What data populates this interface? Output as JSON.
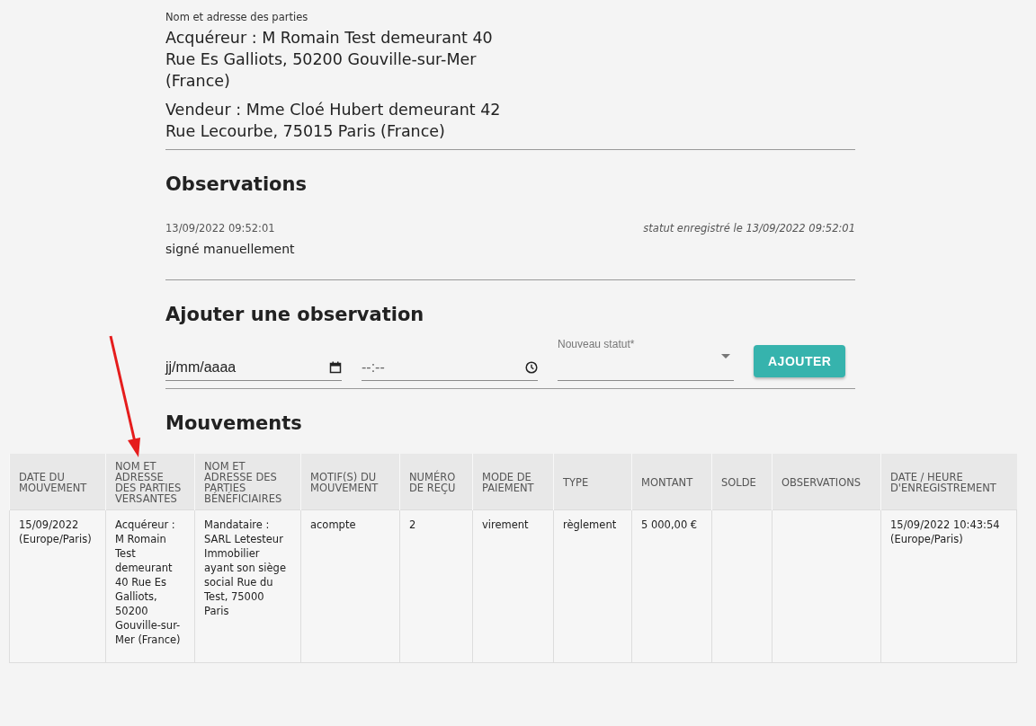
{
  "parties": {
    "label": "Nom et adresse des parties",
    "lines": [
      "Acquéreur : M Romain Test demeurant 40 Rue Es Galliots, 50200 Gouville-sur-Mer (France)",
      "Vendeur : Mme Cloé Hubert demeurant 42 Rue Lecourbe, 75015 Paris (France)"
    ]
  },
  "observations": {
    "title": "Observations",
    "items": [
      {
        "date": "13/09/2022 09:52:01",
        "status_note": "statut enregistré le 13/09/2022 09:52:01",
        "text": "signé manuellement"
      }
    ]
  },
  "add_observation": {
    "title": "Ajouter une observation",
    "date_field": {
      "placeholder": "jj/mm/aaaa"
    },
    "time_field": {
      "placeholder": "--:--"
    },
    "status_select": {
      "label": "Nouveau statut*"
    },
    "button": "AJOUTER"
  },
  "movements": {
    "title": "Mouvements",
    "columns": [
      "DATE DU MOUVEMENT",
      "NOM ET ADRESSE DES PARTIES VERSANTES",
      "NOM ET ADRESSE DES PARTIES BÉNÉFICIAIRES",
      "MOTIF(S) DU MOUVEMENT",
      "NUMÉRO DE REÇU",
      "MODE DE PAIEMENT",
      "TYPE",
      "MONTANT",
      "SOLDE",
      "OBSERVATIONS",
      "DATE / HEURE D'ENREGISTREMENT"
    ],
    "rows": [
      [
        "15/09/2022 (Europe/Paris)",
        "Acquéreur : M Romain Test demeurant 40 Rue Es Galliots, 50200 Gouville-sur-Mer (France)",
        "Mandataire : SARL Letesteur Immobilier ayant son siège social Rue du Test, 75000 Paris",
        "acompte",
        "2",
        "virement",
        "règlement",
        "5 000,00 €",
        "",
        "",
        "15/09/2022 10:43:54 (Europe/Paris)"
      ]
    ]
  }
}
